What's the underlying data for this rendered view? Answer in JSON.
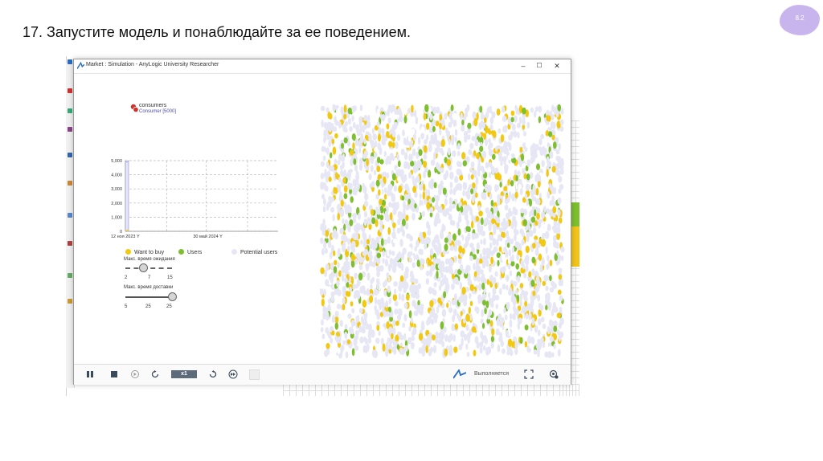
{
  "slide": {
    "number": "8.2",
    "heading": "17. Запустите модель и понаблюдайте за ее поведением."
  },
  "window": {
    "title": "Market : Simulation - AnyLogic University Researcher",
    "buttons": {
      "minimize": "–",
      "maximize": "☐",
      "close": "✕"
    }
  },
  "agents_legend": {
    "name": "consumers",
    "type": "Consumer [5000]"
  },
  "chart_data": {
    "type": "area",
    "x_tick_labels": [
      "12 ноя 2023 Y",
      "30 май 2024 Y"
    ],
    "y_tick_labels": [
      "0",
      "1,000",
      "2,000",
      "3,000",
      "4,000",
      "5,000"
    ],
    "ylim": [
      0,
      5000
    ],
    "grid": true,
    "legend_position": "bottom",
    "series": [
      {
        "name": "Want to buy",
        "color": "#f2c811",
        "values": [
          0,
          120,
          0
        ]
      },
      {
        "name": "Users",
        "color": "#7dbf2e",
        "values": [
          0,
          0,
          0
        ]
      },
      {
        "name": "Potential users",
        "color": "#e6e6f5",
        "values": [
          5000,
          4880,
          5000
        ]
      }
    ]
  },
  "sliders": [
    {
      "label": "Макс. время ожидания",
      "min": "2",
      "value": "7",
      "max": "15",
      "fraction": 0.38
    },
    {
      "label": "Макс. время доставки",
      "min": "5",
      "value": "25",
      "max": "25",
      "fraction": 1.0
    }
  ],
  "toolbar": {
    "icons": [
      "pause-icon",
      "stop-icon",
      "step-icon",
      "slower-icon",
      "faster-icon",
      "fast-forward-icon",
      "virtual-time-icon",
      "anylogic-logo",
      "fullscreen-icon",
      "settings-icon"
    ],
    "speed": "x1",
    "status": "Выполняется"
  },
  "colors": {
    "want_to_buy": "#f2c811",
    "users": "#7dbf2e",
    "potential": "#e6e6f5",
    "accent": "#1f6fc0"
  }
}
